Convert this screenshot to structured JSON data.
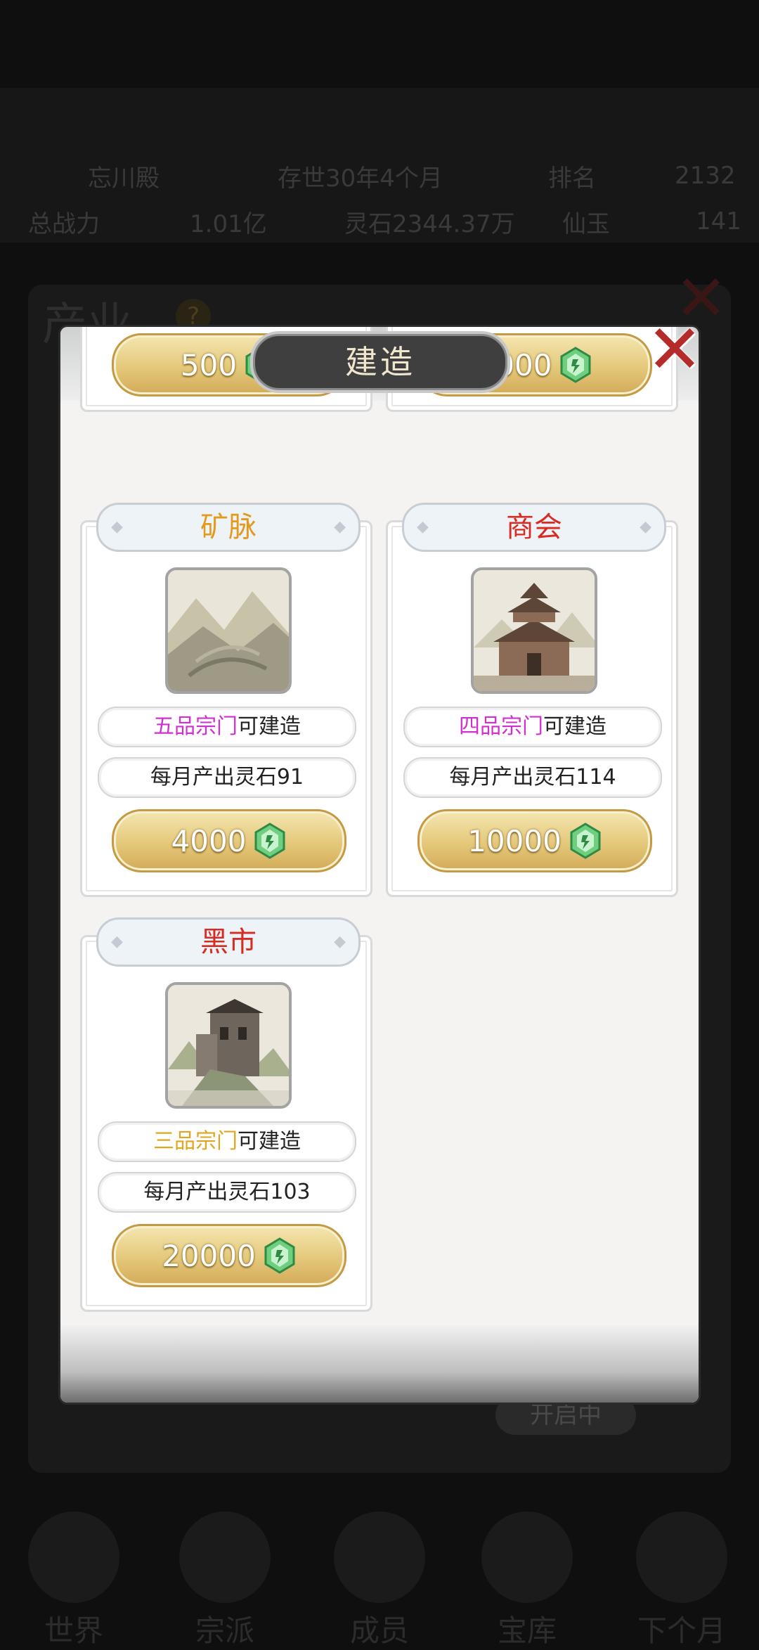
{
  "background": {
    "status_line1": [
      "忘川殿",
      "存世30年4个月",
      "排名",
      "2132"
    ],
    "status_line2": [
      "总战力",
      "1.01亿",
      "灵石2344.37万",
      "仙玉",
      "141"
    ],
    "panel_title": "产业",
    "help_icon_char": "?",
    "toggle_label": "开启中",
    "nav": [
      "世界",
      "宗派",
      "成员",
      "宝库",
      "下个月"
    ]
  },
  "dialog": {
    "title": "建造",
    "close_icon": "close-x-icon"
  },
  "cards_partial": [
    {
      "cost": "500"
    },
    {
      "cost": "2000"
    }
  ],
  "cards": [
    {
      "name": "矿脉",
      "name_color": "#e39a1d",
      "image_icon": "mountain-mine-icon",
      "grade": "五品宗门",
      "grade_color": "#d12fd1",
      "req_suffix": "可建造",
      "income": "每月产出灵石91",
      "cost": "4000"
    },
    {
      "name": "商会",
      "name_color": "#d82c22",
      "image_icon": "pagoda-hall-icon",
      "grade": "四品宗门",
      "grade_color": "#d12fd1",
      "req_suffix": "可建造",
      "income": "每月产出灵石114",
      "cost": "10000"
    },
    {
      "name": "黑市",
      "name_color": "#d82c22",
      "image_icon": "cliff-fortress-icon",
      "grade": "三品宗门",
      "grade_color": "#e2a51e",
      "req_suffix": "可建造",
      "income": "每月产出灵石103",
      "cost": "20000"
    }
  ],
  "currency_icon": "spirit-stone-icon"
}
